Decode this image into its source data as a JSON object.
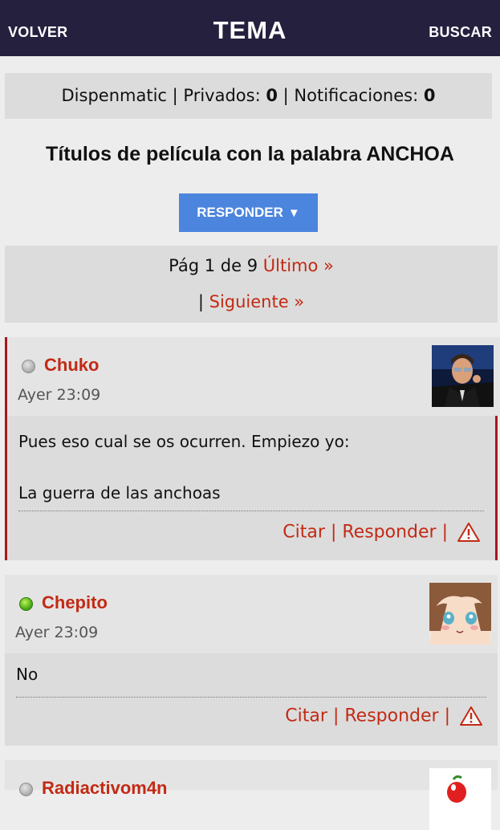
{
  "topbar": {
    "back_label": "VOLVER",
    "title": "TEMA",
    "search_label": "BUSCAR"
  },
  "userbar": {
    "username": "Dispenmatic",
    "private_label": "Privados:",
    "private_count": "0",
    "notifications_label": "Notificaciones:",
    "notifications_count": "0"
  },
  "thread": {
    "title": "Títulos de película con la palabra ANCHOA"
  },
  "reply_button": {
    "label": "RESPONDER",
    "arrow": "▼"
  },
  "pagination": {
    "page_text": "Pág 1 de 9",
    "last_label": "Último »",
    "separator": "|",
    "next_label": "Siguiente »"
  },
  "posts": [
    {
      "author": "Chuko",
      "online": false,
      "time": "Ayer 23:09",
      "body": "Pues eso cual se os ocurren. Empiezo yo:\n\nLa guerra de las anchoas",
      "quote_label": "Citar",
      "reply_label": "Responder",
      "sep": "|"
    },
    {
      "author": "Chepito",
      "online": true,
      "time": "Ayer 23:09",
      "body": "No",
      "quote_label": "Citar",
      "reply_label": "Responder",
      "sep": "|"
    },
    {
      "author": "Radiactivom4n",
      "online": false
    }
  ],
  "colors": {
    "topbar": "#26203f",
    "accent_red": "#c22a14",
    "button_blue": "#4c85de"
  }
}
